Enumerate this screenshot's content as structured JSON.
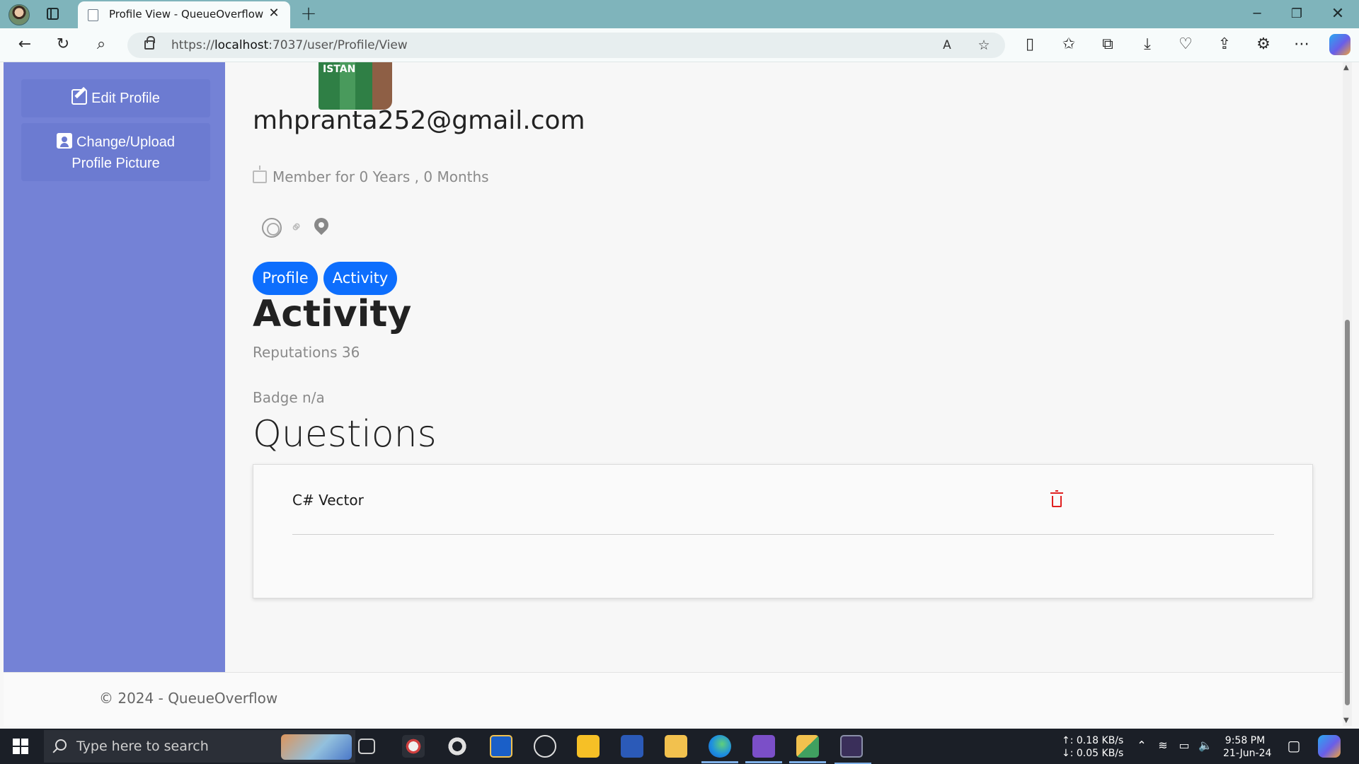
{
  "browser": {
    "tab_title": "Profile View - QueueOverflow.Web",
    "tab_close": "✕",
    "new_tab": "+",
    "window_controls": {
      "minimize": "─",
      "maximize": "❐",
      "close": "✕"
    },
    "url_prefix": "https://",
    "url_host": "localhost",
    "url_path": ":7037/user/Profile/View",
    "toolbar_icons": [
      "back-icon",
      "refresh-icon",
      "search-icon",
      "read-aloud-icon",
      "favorite-star-icon",
      "split-screen-icon",
      "favorites-icon",
      "collections-icon",
      "downloads-icon",
      "browser-essentials-icon",
      "share-icon",
      "extensions-icon",
      "more-icon",
      "copilot-icon"
    ],
    "glyphs": {
      "back": "←",
      "refresh": "↻",
      "search": "⌕",
      "read_aloud": "A",
      "star": "☆",
      "split": "▯",
      "favorites": "✩",
      "collections": "⧉",
      "downloads": "⤓",
      "essentials": "♡",
      "share": "⇪",
      "extensions": "⚙",
      "more": "⋯"
    }
  },
  "sidebar": {
    "edit_profile": "Edit Profile",
    "change_upload_line1": "Change/Upload",
    "change_upload_line2": "Profile Picture"
  },
  "profile": {
    "jersey_text": "ISTAN",
    "email": "mhpranta252@gmail.com",
    "member_for": "Member for 0 Years , 0 Months",
    "social_icons": [
      "github-icon",
      "link-icon",
      "location-pin-icon"
    ],
    "link_glyph": "⚭",
    "tabs": [
      "Profile",
      "Activity"
    ]
  },
  "activity": {
    "heading": "Activity",
    "reputation": "Reputations 36",
    "badge": "Badge n/a"
  },
  "questions": {
    "heading": "Questions",
    "items": [
      {
        "title": "C# Vector"
      }
    ]
  },
  "footer": {
    "text": "© 2024 - QueueOverflow"
  },
  "scrollbar": {
    "up": "▲",
    "down": "▼"
  },
  "taskbar": {
    "search_placeholder": "Type here to search",
    "net_up": "↑: 0.18 KB/s",
    "net_down": "↓: 0.05 KB/s",
    "time": "9:58 PM",
    "date": "21-Jun-24",
    "tray_glyphs": {
      "chevron": "⌃",
      "wifi": "≋",
      "battery": "▭",
      "volume": "🔈",
      "notifications": "▢"
    },
    "colors": {
      "edge": "#1d8fe0",
      "word": "#2b5ab8",
      "vs": "#7b4fc8",
      "explorer": "#f2c14e",
      "keep": "#f6c026",
      "settings": "#e0e0e0"
    }
  },
  "colors": {
    "accent": "#0d6efd",
    "sidebar": "#7482d6",
    "delete": "#e02020",
    "tabstrip": "#7fb4bb"
  }
}
